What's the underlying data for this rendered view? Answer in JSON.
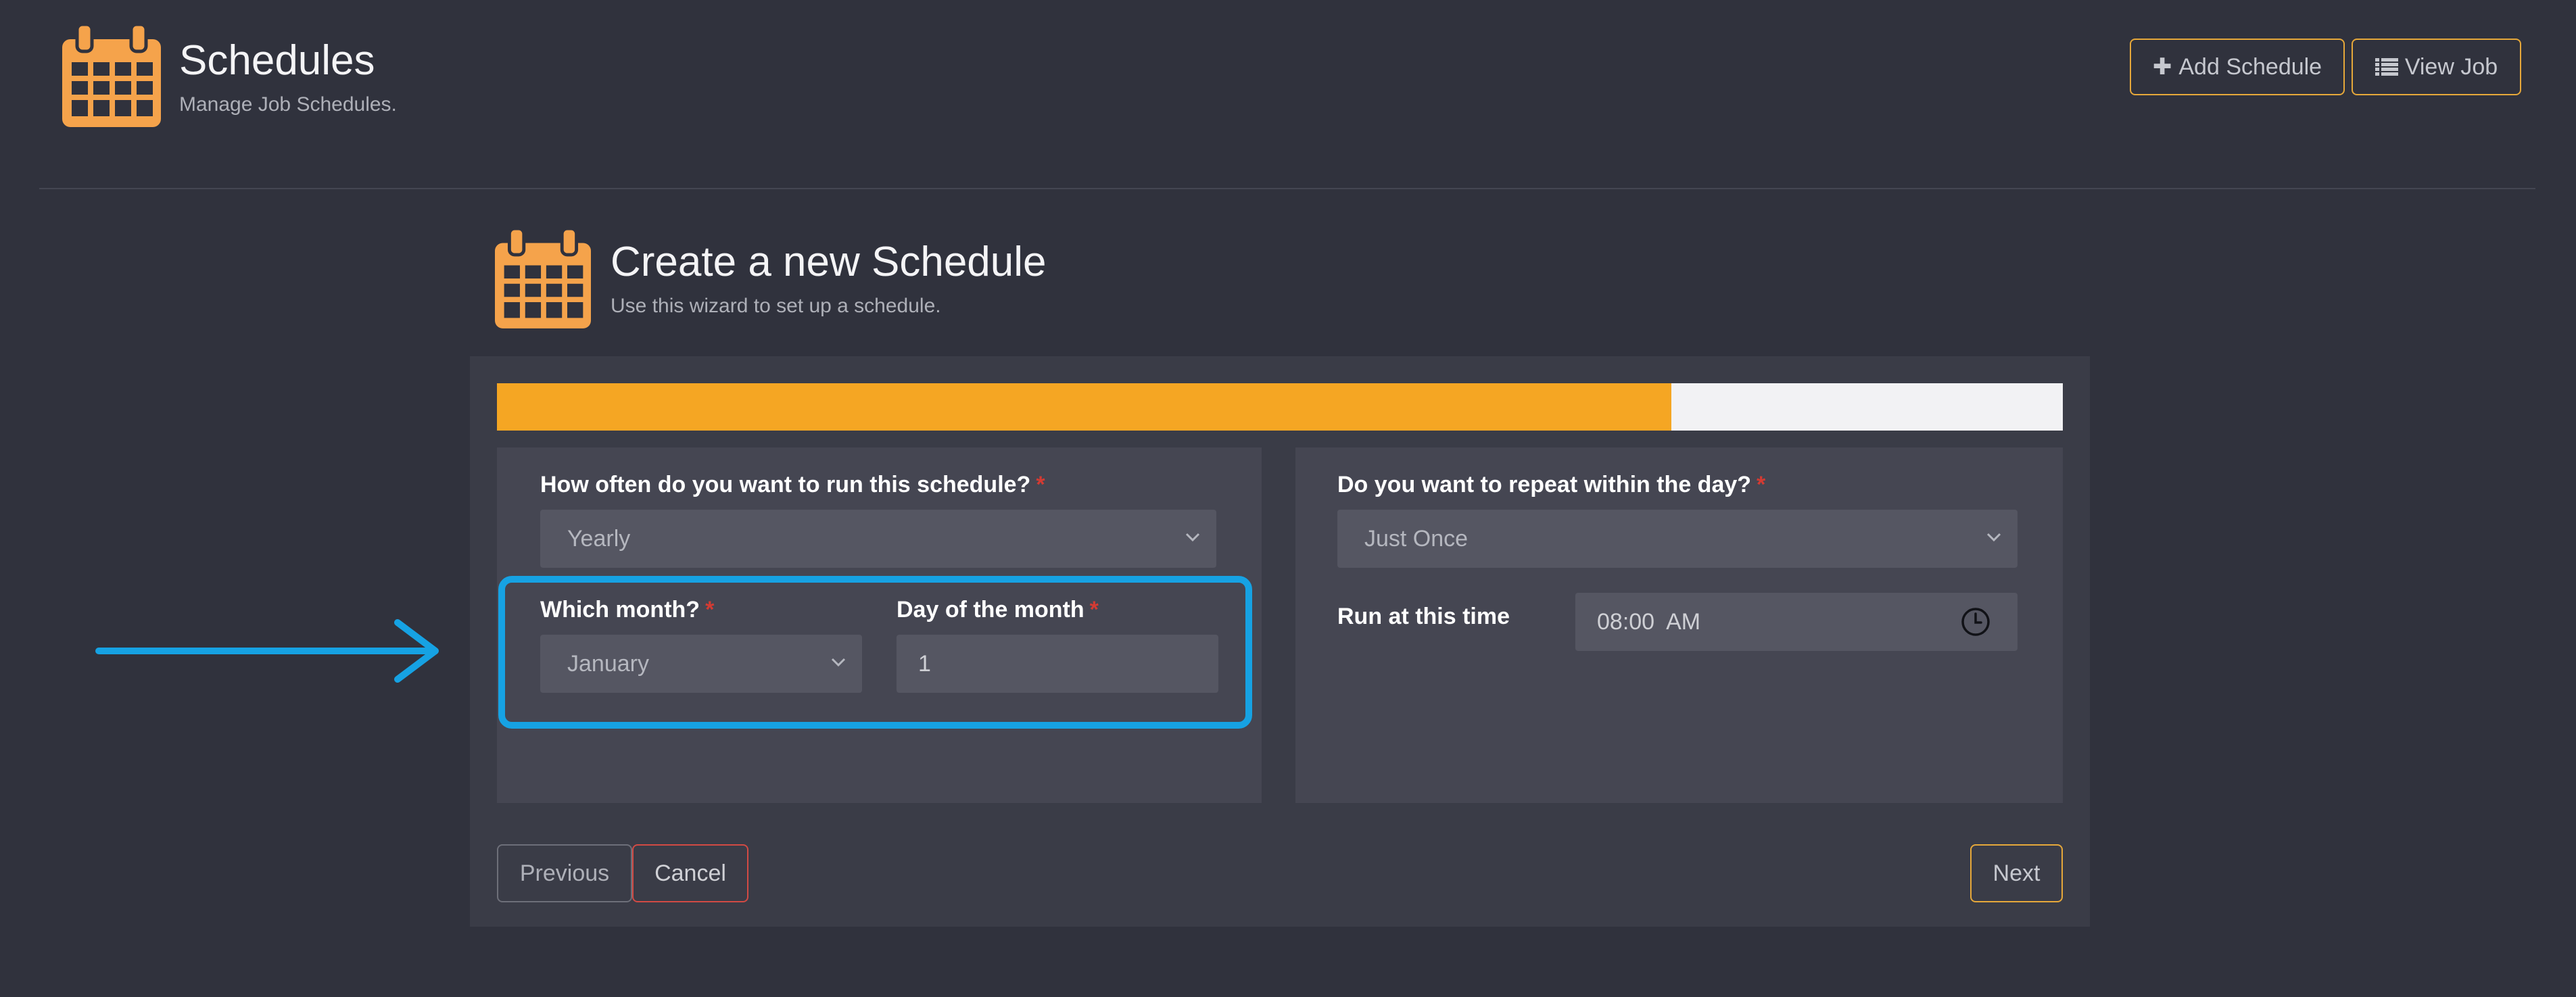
{
  "header": {
    "title": "Schedules",
    "subtitle": "Manage Job Schedules.",
    "icon": "calendar-icon",
    "actions": {
      "add_schedule": "Add Schedule",
      "add_icon": "plus-icon",
      "view_job": "View Job",
      "view_icon": "list-icon"
    }
  },
  "wizard": {
    "title": "Create a new Schedule",
    "subtitle": "Use this wizard to set up a schedule.",
    "icon": "calendar-icon",
    "progress_fraction": 0.75,
    "frequency": {
      "label": "How often do you want to run this schedule?",
      "required_mark": "*",
      "value": "Yearly"
    },
    "month": {
      "label": "Which month?",
      "required_mark": "*",
      "value": "January"
    },
    "day_of_month": {
      "label": "Day of the month",
      "required_mark": "*",
      "value": "1"
    },
    "repeat": {
      "label": "Do you want to repeat within the day?",
      "required_mark": "*",
      "value": "Just Once"
    },
    "run_time": {
      "label": "Run at this time",
      "value": "08:00  AM",
      "icon": "clock-icon"
    },
    "footer": {
      "previous": "Previous",
      "cancel": "Cancel",
      "next": "Next"
    }
  },
  "colors": {
    "background": "#30323d",
    "accent": "#f5a623",
    "highlight": "#16a2e3",
    "required": "#d33b33",
    "danger": "#d24a44"
  }
}
